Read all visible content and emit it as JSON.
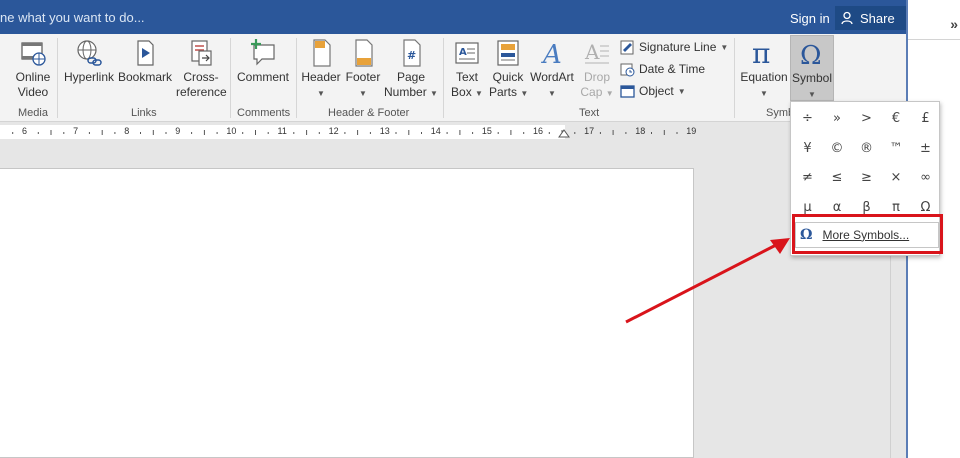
{
  "titlebar": {
    "tell_me": "ne what you want to do...",
    "sign_in": "Sign in",
    "share": "Share"
  },
  "ribbon": {
    "media": {
      "online_video_1": "Online",
      "online_video_2": "Video",
      "group": "Media"
    },
    "links": {
      "hyperlink": "Hyperlink",
      "bookmark": "Bookmark",
      "cross_ref_1": "Cross-",
      "cross_ref_2": "reference",
      "group": "Links"
    },
    "comments": {
      "comment": "Comment",
      "group": "Comments"
    },
    "header_footer": {
      "header": "Header",
      "footer": "Footer",
      "page_number_1": "Page",
      "page_number_2": "Number",
      "group": "Header & Footer"
    },
    "text": {
      "text_box_1": "Text",
      "text_box_2": "Box",
      "quick_parts_1": "Quick",
      "quick_parts_2": "Parts",
      "wordart": "WordArt",
      "drop_cap_1": "Drop",
      "drop_cap_2": "Cap",
      "signature_line": "Signature Line",
      "date_time": "Date & Time",
      "object": "Object",
      "group": "Text"
    },
    "symbols": {
      "equation": "Equation",
      "symbol": "Symbol",
      "group": "Symb"
    }
  },
  "ruler": {
    "numbers": [
      "6",
      "7",
      "8",
      "9",
      "10",
      "11",
      "12",
      "13",
      "14",
      "15",
      "16",
      "17",
      "18",
      "19"
    ]
  },
  "symbol_menu": {
    "symbols": [
      [
        "÷",
        "»",
        ">",
        "€",
        "£"
      ],
      [
        "¥",
        "©",
        "®",
        "™",
        "±"
      ],
      [
        "≠",
        "≤",
        "≥",
        "×",
        "∞"
      ],
      [
        "µ",
        "α",
        "β",
        "π",
        "Ω"
      ]
    ],
    "more_symbols": "More Symbols..."
  },
  "colors": {
    "titlebar": "#2b579a",
    "annotation_red": "#d9141b",
    "accent_blue": "#2b579a"
  }
}
